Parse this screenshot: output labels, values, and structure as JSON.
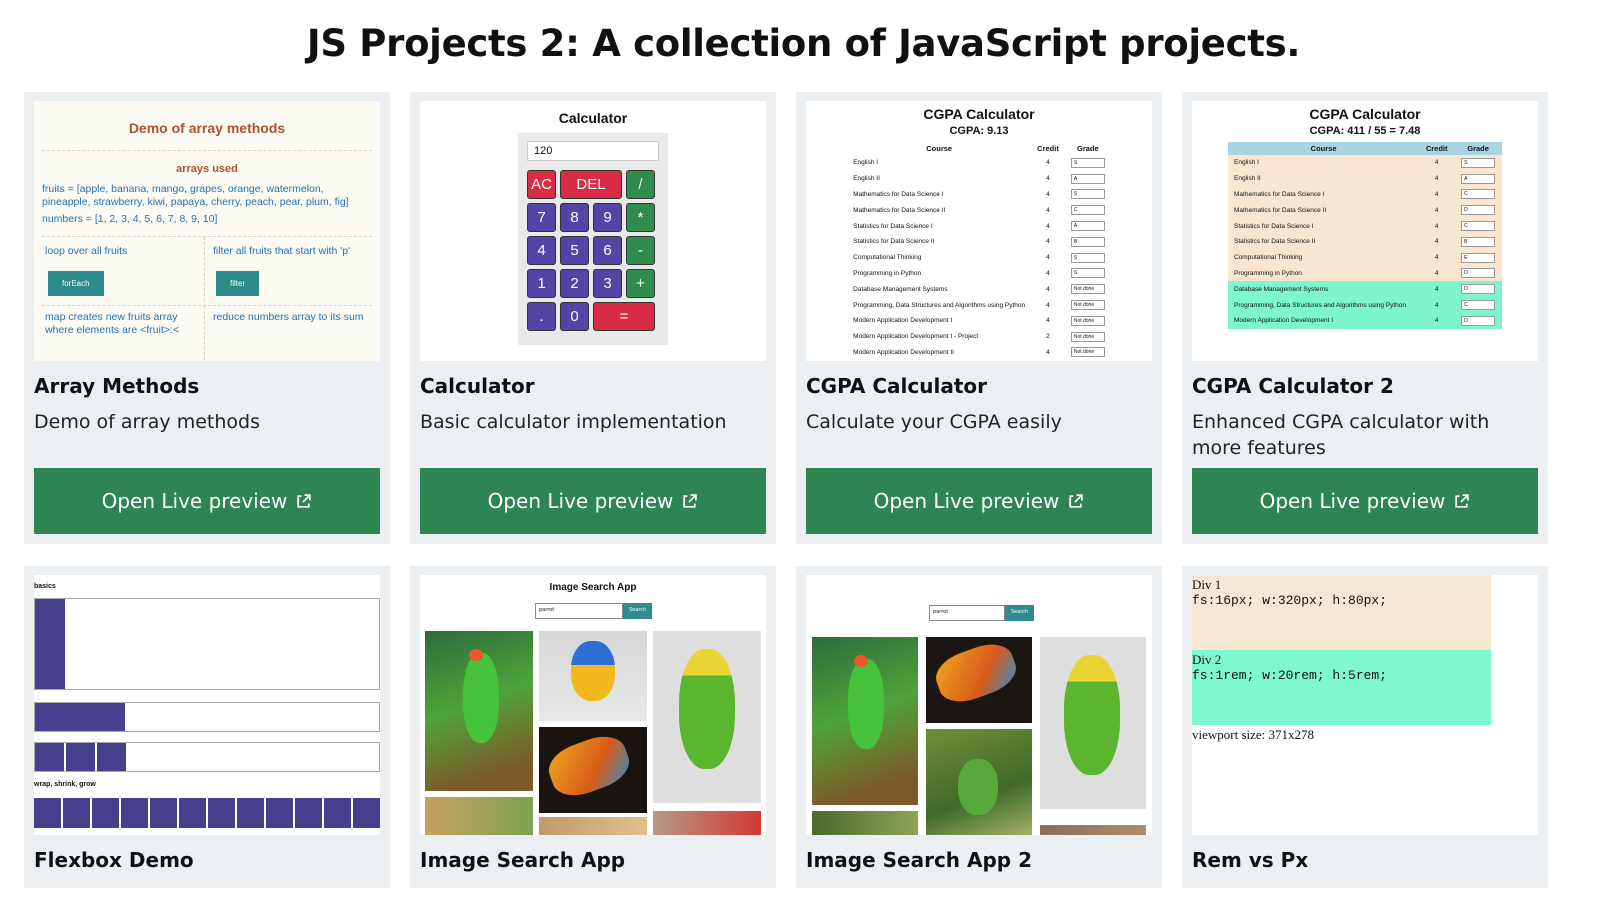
{
  "page": {
    "title": "JS Projects 2: A collection of JavaScript projects."
  },
  "colors": {
    "button": "#2c8552",
    "card_bg": "#eceff2"
  },
  "cards": [
    {
      "title": "Array Methods",
      "description": "Demo of array methods",
      "button": "Open Live preview",
      "preview": {
        "heading": "Demo of array methods",
        "subheading": "arrays used",
        "fruits": "fruits = [apple, banana, mango, grapes, orange, watermelon, pineapple, strawberry, kiwi, papaya, cherry, peach, pear, plum, fig]",
        "numbers": "numbers = [1, 2, 3, 4, 5, 6, 7, 8, 9, 10]",
        "loop_text": "loop over all fruits",
        "loop_btn": "forEach",
        "filter_text": "filter all fruits that start with 'p'",
        "filter_btn": "filter",
        "map_text": "map creates new fruits array where elements are <fruit>:<",
        "reduce_text": "reduce numbers array to its sum"
      }
    },
    {
      "title": "Calculator",
      "description": "Basic calculator implementation",
      "button": "Open Live preview",
      "preview": {
        "heading": "Calculator",
        "display": "120",
        "keys": [
          {
            "label": "AC",
            "kind": "red"
          },
          {
            "label": "DEL",
            "kind": "red w2"
          },
          {
            "label": "/",
            "kind": "op"
          },
          {
            "label": "7",
            "kind": "num"
          },
          {
            "label": "8",
            "kind": "num"
          },
          {
            "label": "9",
            "kind": "num"
          },
          {
            "label": "*",
            "kind": "op"
          },
          {
            "label": "4",
            "kind": "num"
          },
          {
            "label": "5",
            "kind": "num"
          },
          {
            "label": "6",
            "kind": "num"
          },
          {
            "label": "-",
            "kind": "op"
          },
          {
            "label": "1",
            "kind": "num"
          },
          {
            "label": "2",
            "kind": "num"
          },
          {
            "label": "3",
            "kind": "num"
          },
          {
            "label": "+",
            "kind": "op"
          },
          {
            "label": ".",
            "kind": "num"
          },
          {
            "label": "0",
            "kind": "num"
          },
          {
            "label": "=",
            "kind": "red w2"
          }
        ]
      }
    },
    {
      "title": "CGPA Calculator",
      "description": "Calculate your CGPA easily",
      "button": "Open Live preview",
      "preview": {
        "heading": "CGPA Calculator",
        "summary": "CGPA: 9.13",
        "columns": [
          "Course",
          "Credit",
          "Grade"
        ],
        "rows": [
          [
            "English I",
            "4",
            "S"
          ],
          [
            "English II",
            "4",
            "A"
          ],
          [
            "Mathematics for Data Science I",
            "4",
            "S"
          ],
          [
            "Mathematics for Data Science II",
            "4",
            "C"
          ],
          [
            "Statistics for Data Science I",
            "4",
            "A"
          ],
          [
            "Statistics for Data Science II",
            "4",
            "B"
          ],
          [
            "Computational Thinking",
            "4",
            "S"
          ],
          [
            "Programming in Python",
            "4",
            "S"
          ],
          [
            "Database Management Systems",
            "4",
            "Not done"
          ],
          [
            "Programming, Data Structures and Algorithms using Python",
            "4",
            "Not done"
          ],
          [
            "Modern Application Development I",
            "4",
            "Not done"
          ],
          [
            "Modern Application Development I - Project",
            "2",
            "Not done"
          ],
          [
            "Modern Application Development II",
            "4",
            "Not done"
          ]
        ]
      }
    },
    {
      "title": "CGPA Calculator 2",
      "description": "Enhanced CGPA calculator with more features",
      "button": "Open Live preview",
      "preview": {
        "heading": "CGPA Calculator",
        "summary": "CGPA: 411 / 55 = 7.48",
        "columns": [
          "Course",
          "Credit",
          "Grade"
        ],
        "rows": [
          [
            "English I",
            "4",
            "S"
          ],
          [
            "English II",
            "4",
            "A"
          ],
          [
            "Mathematics for Data Science I",
            "4",
            "C"
          ],
          [
            "Mathematics for Data Science II",
            "4",
            "D"
          ],
          [
            "Statistics for Data Science I",
            "4",
            "C"
          ],
          [
            "Statistics for Data Science II",
            "4",
            "B"
          ],
          [
            "Computational Thinking",
            "4",
            "E"
          ],
          [
            "Programming in Python",
            "4",
            "D"
          ],
          [
            "Database Management Systems",
            "4",
            "D"
          ],
          [
            "Programming, Data Structures and Algorithms using Python",
            "4",
            "C"
          ],
          [
            "Modern Application Development I",
            "4",
            "D"
          ]
        ]
      }
    },
    {
      "title": "Flexbox Demo",
      "preview": {
        "basics": "basics",
        "wrap": "wrap, shrink, grow"
      }
    },
    {
      "title": "Image Search App",
      "preview": {
        "heading": "Image Search App",
        "query": "parrot",
        "search_btn": "Search"
      }
    },
    {
      "title": "Image Search App 2",
      "preview": {
        "query": "parrot",
        "search_btn": "Search"
      }
    },
    {
      "title": "Rem vs Px",
      "preview": {
        "div1_label": "Div 1",
        "div1_code": "fs:16px; w:320px; h:80px;",
        "div2_label": "Div 2",
        "div2_code": "fs:1rem; w:20rem; h:5rem;",
        "viewport": "viewport size: 371x278"
      }
    }
  ]
}
